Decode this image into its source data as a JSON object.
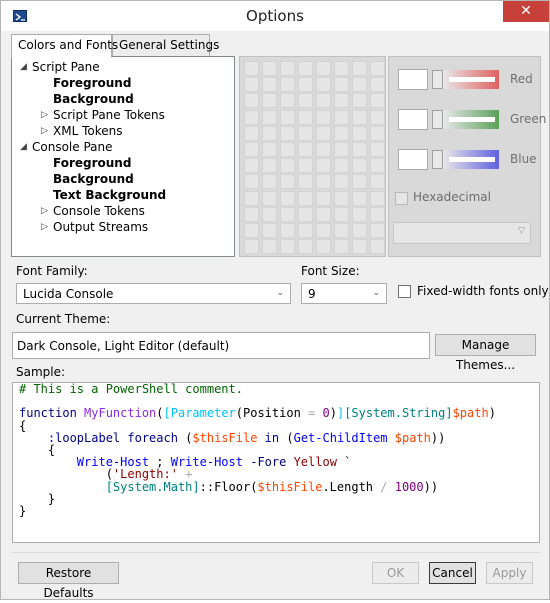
{
  "window": {
    "title": "Options",
    "close_label": "✕"
  },
  "tabs": [
    {
      "label": "Colors and Fonts",
      "active": true
    },
    {
      "label": "General Settings",
      "active": false
    }
  ],
  "tree": {
    "items": [
      {
        "label": "Script Pane",
        "expanded": true,
        "bold": false,
        "level": 0
      },
      {
        "label": "Foreground",
        "bold": true,
        "level": 2
      },
      {
        "label": "Background",
        "bold": true,
        "level": 2
      },
      {
        "label": "Script Pane Tokens",
        "expanded": false,
        "bold": false,
        "level": 1
      },
      {
        "label": "XML Tokens",
        "expanded": false,
        "bold": false,
        "level": 1
      },
      {
        "label": "Console Pane",
        "expanded": true,
        "bold": false,
        "level": 0
      },
      {
        "label": "Foreground",
        "bold": true,
        "level": 2
      },
      {
        "label": "Background",
        "bold": true,
        "level": 2
      },
      {
        "label": "Text Background",
        "bold": true,
        "level": 2
      },
      {
        "label": "Console Tokens",
        "expanded": false,
        "bold": false,
        "level": 1
      },
      {
        "label": "Output Streams",
        "expanded": false,
        "bold": false,
        "level": 1
      }
    ]
  },
  "color_editor": {
    "channels": [
      {
        "label": "Red",
        "color": "#e06060"
      },
      {
        "label": "Green",
        "color": "#5aa05a"
      },
      {
        "label": "Blue",
        "color": "#6060e0"
      }
    ],
    "hexadecimal_label": "Hexadecimal"
  },
  "font": {
    "family_label": "Font Family:",
    "family_value": "Lucida Console",
    "size_label": "Font Size:",
    "size_value": "9",
    "fixed_width_label": "Fixed-width fonts only"
  },
  "theme": {
    "label": "Current Theme:",
    "value": "Dark Console, Light Editor (default)",
    "manage_label": "Manage Themes..."
  },
  "sample": {
    "label": "Sample:",
    "lines": [
      [
        [
          "c-comment",
          "# This is a PowerShell comment."
        ]
      ],
      [],
      [
        [
          "c-kw",
          "function "
        ],
        [
          "c-fn",
          "MyFunction"
        ],
        [
          "c-plain",
          "("
        ],
        [
          "c-attr",
          "[Parameter"
        ],
        [
          "c-plain",
          "(Position "
        ],
        [
          "c-op",
          "="
        ],
        [
          "c-plain",
          " "
        ],
        [
          "c-num",
          "0"
        ],
        [
          "c-plain",
          ")"
        ],
        [
          "c-attr",
          "]"
        ],
        [
          "c-type",
          "[System.String]"
        ],
        [
          "c-var",
          "$path"
        ],
        [
          "c-plain",
          ")"
        ]
      ],
      [
        [
          "c-plain",
          "{"
        ]
      ],
      [
        [
          "c-plain",
          "    "
        ],
        [
          "c-kw",
          ":loopLabel foreach "
        ],
        [
          "c-plain",
          "("
        ],
        [
          "c-var",
          "$thisFile"
        ],
        [
          "c-kw",
          " in "
        ],
        [
          "c-plain",
          "("
        ],
        [
          "c-cmd",
          "Get-ChildItem "
        ],
        [
          "c-var",
          "$path"
        ],
        [
          "c-plain",
          "))"
        ]
      ],
      [
        [
          "c-plain",
          "    {"
        ]
      ],
      [
        [
          "c-plain",
          "        "
        ],
        [
          "c-cmd",
          "Write-Host"
        ],
        [
          "c-plain",
          " ; "
        ],
        [
          "c-cmd",
          "Write-Host "
        ],
        [
          "c-param",
          "-Fore "
        ],
        [
          "c-str",
          "Yellow "
        ],
        [
          "c-plain",
          "`"
        ]
      ],
      [
        [
          "c-plain",
          "            ("
        ],
        [
          "c-str",
          "'Length:'"
        ],
        [
          "c-plain",
          " "
        ],
        [
          "c-op",
          "+"
        ]
      ],
      [
        [
          "c-plain",
          "            "
        ],
        [
          "c-type",
          "[System.Math]"
        ],
        [
          "c-plain",
          "::Floor("
        ],
        [
          "c-var",
          "$thisFile"
        ],
        [
          "c-plain",
          ".Length "
        ],
        [
          "c-op",
          "/"
        ],
        [
          "c-plain",
          " "
        ],
        [
          "c-num",
          "1000"
        ],
        [
          "c-plain",
          "))"
        ]
      ],
      [
        [
          "c-plain",
          "    }"
        ]
      ],
      [
        [
          "c-plain",
          "}"
        ]
      ]
    ]
  },
  "buttons": {
    "restore_defaults": "Restore Defaults",
    "ok": "OK",
    "cancel": "Cancel",
    "apply": "Apply"
  }
}
